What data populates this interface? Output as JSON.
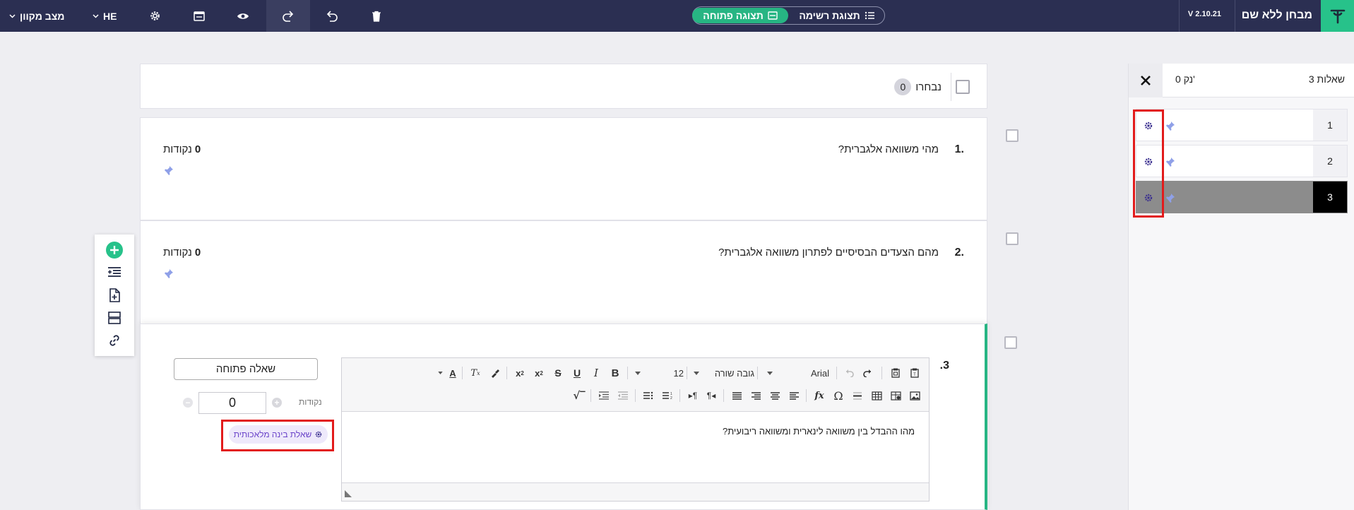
{
  "topbar": {
    "app_title": "מבחן ללא שם",
    "version": "V 2.10.21",
    "view_open_label": "תצוגה פתוחה",
    "view_list_label": "תצוגת רשימה",
    "language": "HE",
    "mode_label": "מצב מקוון",
    "icons": [
      "logo-icon",
      "delete-icon",
      "undo-icon",
      "redo-icon",
      "preview-icon",
      "publish-icon",
      "settings-icon"
    ]
  },
  "sidebar": {
    "question_count": "3 שאלות",
    "points_total": "0 נק'",
    "items": [
      {
        "number": "1"
      },
      {
        "number": "2"
      },
      {
        "number": "3",
        "active": true
      }
    ]
  },
  "selection_bar": {
    "selected_label": "נבחרו",
    "selected_count": "0"
  },
  "questions": [
    {
      "number": "1.",
      "text": "מהי משוואה אלגברית?",
      "points_value": "0",
      "points_label": "נקודות"
    },
    {
      "number": "2.",
      "text": "מהם הצעדים הבסיסיים לפתרון משוואה אלגברית?",
      "points_value": "0",
      "points_label": "נקודות"
    },
    {
      "number": ".3"
    }
  ],
  "editor": {
    "font_name": "Arial",
    "line_height_label": "גובה שורה",
    "font_size": "12",
    "content": "מהו ההבדל בין משוואה לינארית ומשוואה ריבועית?"
  },
  "question_settings": {
    "type_label": "שאלה פתוחה",
    "points_label": "נקודות",
    "points_value": "0",
    "ai_tag_label": "שאלת בינה מלאכותית"
  },
  "colors": {
    "topbar_bg": "#2b2f52",
    "accent_green": "#27c28a",
    "highlight_red": "#e21b1b",
    "ai_purple": "#6a43c9"
  }
}
